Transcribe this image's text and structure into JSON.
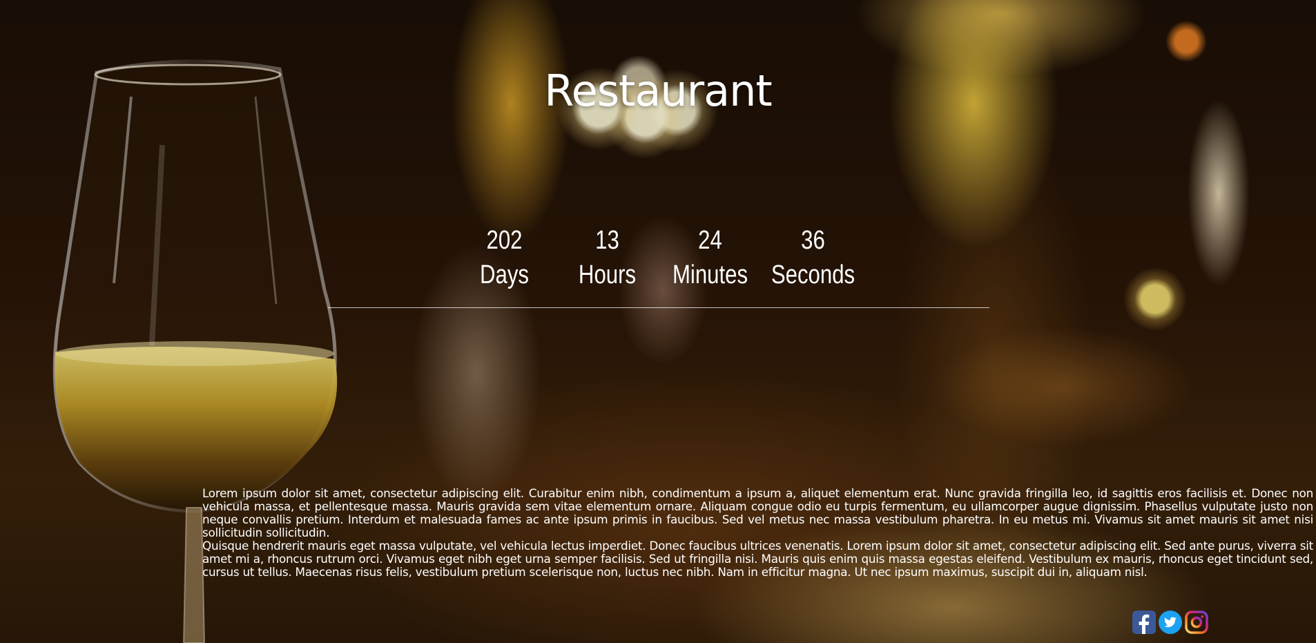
{
  "header": {
    "title": "Restaurant"
  },
  "countdown": [
    {
      "value": "202",
      "label": "Days"
    },
    {
      "value": "13",
      "label": "Hours"
    },
    {
      "value": "24",
      "label": "Minutes"
    },
    {
      "value": "36",
      "label": "Seconds"
    }
  ],
  "description": {
    "paragraph_1": "Lorem ipsum dolor sit amet, consectetur adipiscing elit. Curabitur enim nibh, condimentum a ipsum a, aliquet elementum erat. Nunc gravida fringilla leo, id sagittis eros facilisis et. Donec non vehicula massa, et pellentesque massa. Mauris gravida sem vitae elementum ornare. Aliquam congue odio eu turpis fermentum, eu ullamcorper augue dignissim. Phasellus vulputate justo non neque convallis pretium. Interdum et malesuada fames ac ante ipsum primis in faucibus. Sed vel metus nec massa vestibulum pharetra. In eu metus mi. Vivamus sit amet mauris sit amet nisi sollicitudin sollicitudin.",
    "paragraph_2": "Quisque hendrerit mauris eget massa vulputate, vel vehicula lectus imperdiet. Donec faucibus ultrices venenatis. Lorem ipsum dolor sit amet, consectetur adipiscing elit. Sed ante purus, viverra sit amet mi a, rhoncus rutrum orci. Vivamus eget nibh eget urna semper facilisis. Sed ut fringilla nisi. Mauris quis enim quis massa egestas eleifend. Vestibulum ex mauris, rhoncus eget tincidunt sed, cursus ut tellus. Maecenas risus felis, vestibulum pretium scelerisque non, luctus nec nibh. Nam in efficitur magna. Ut nec ipsum maximus, suscipit dui in, aliquam nisl."
  },
  "social": [
    {
      "icon": "facebook-icon",
      "color": "#3b5998"
    },
    {
      "icon": "twitter-icon",
      "color": "#1da1f2"
    },
    {
      "icon": "instagram-icon",
      "color": "#c13584"
    }
  ]
}
